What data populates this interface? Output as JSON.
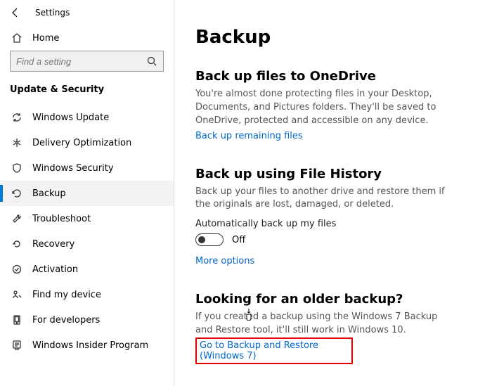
{
  "app": {
    "title": "Settings"
  },
  "sidebar": {
    "home": "Home",
    "search_placeholder": "Find a setting",
    "category": "Update & Security",
    "items": [
      {
        "label": "Windows Update",
        "icon": "sync"
      },
      {
        "label": "Delivery Optimization",
        "icon": "delivery"
      },
      {
        "label": "Windows Security",
        "icon": "shield"
      },
      {
        "label": "Backup",
        "icon": "backup",
        "active": true
      },
      {
        "label": "Troubleshoot",
        "icon": "troubleshoot"
      },
      {
        "label": "Recovery",
        "icon": "recovery"
      },
      {
        "label": "Activation",
        "icon": "activation"
      },
      {
        "label": "Find my device",
        "icon": "find"
      },
      {
        "label": "For developers",
        "icon": "developer"
      },
      {
        "label": "Windows Insider Program",
        "icon": "insider"
      }
    ]
  },
  "main": {
    "title": "Backup",
    "onedrive": {
      "heading": "Back up files to OneDrive",
      "desc": "You're almost done protecting files in your Desktop, Documents, and Pictures folders. They'll be saved to OneDrive, protected and accessible on any device.",
      "link": "Back up remaining files"
    },
    "filehistory": {
      "heading": "Back up using File History",
      "desc": "Back up your files to another drive and restore them if the originals are lost, damaged, or deleted.",
      "toggle_label": "Automatically back up my files",
      "toggle_state": "Off",
      "more": "More options"
    },
    "older": {
      "heading": "Looking for an older backup?",
      "desc": "If you created a backup using the Windows 7 Backup and Restore tool, it'll still work in Windows 10.",
      "link": "Go to Backup and Restore (Windows 7)"
    }
  }
}
